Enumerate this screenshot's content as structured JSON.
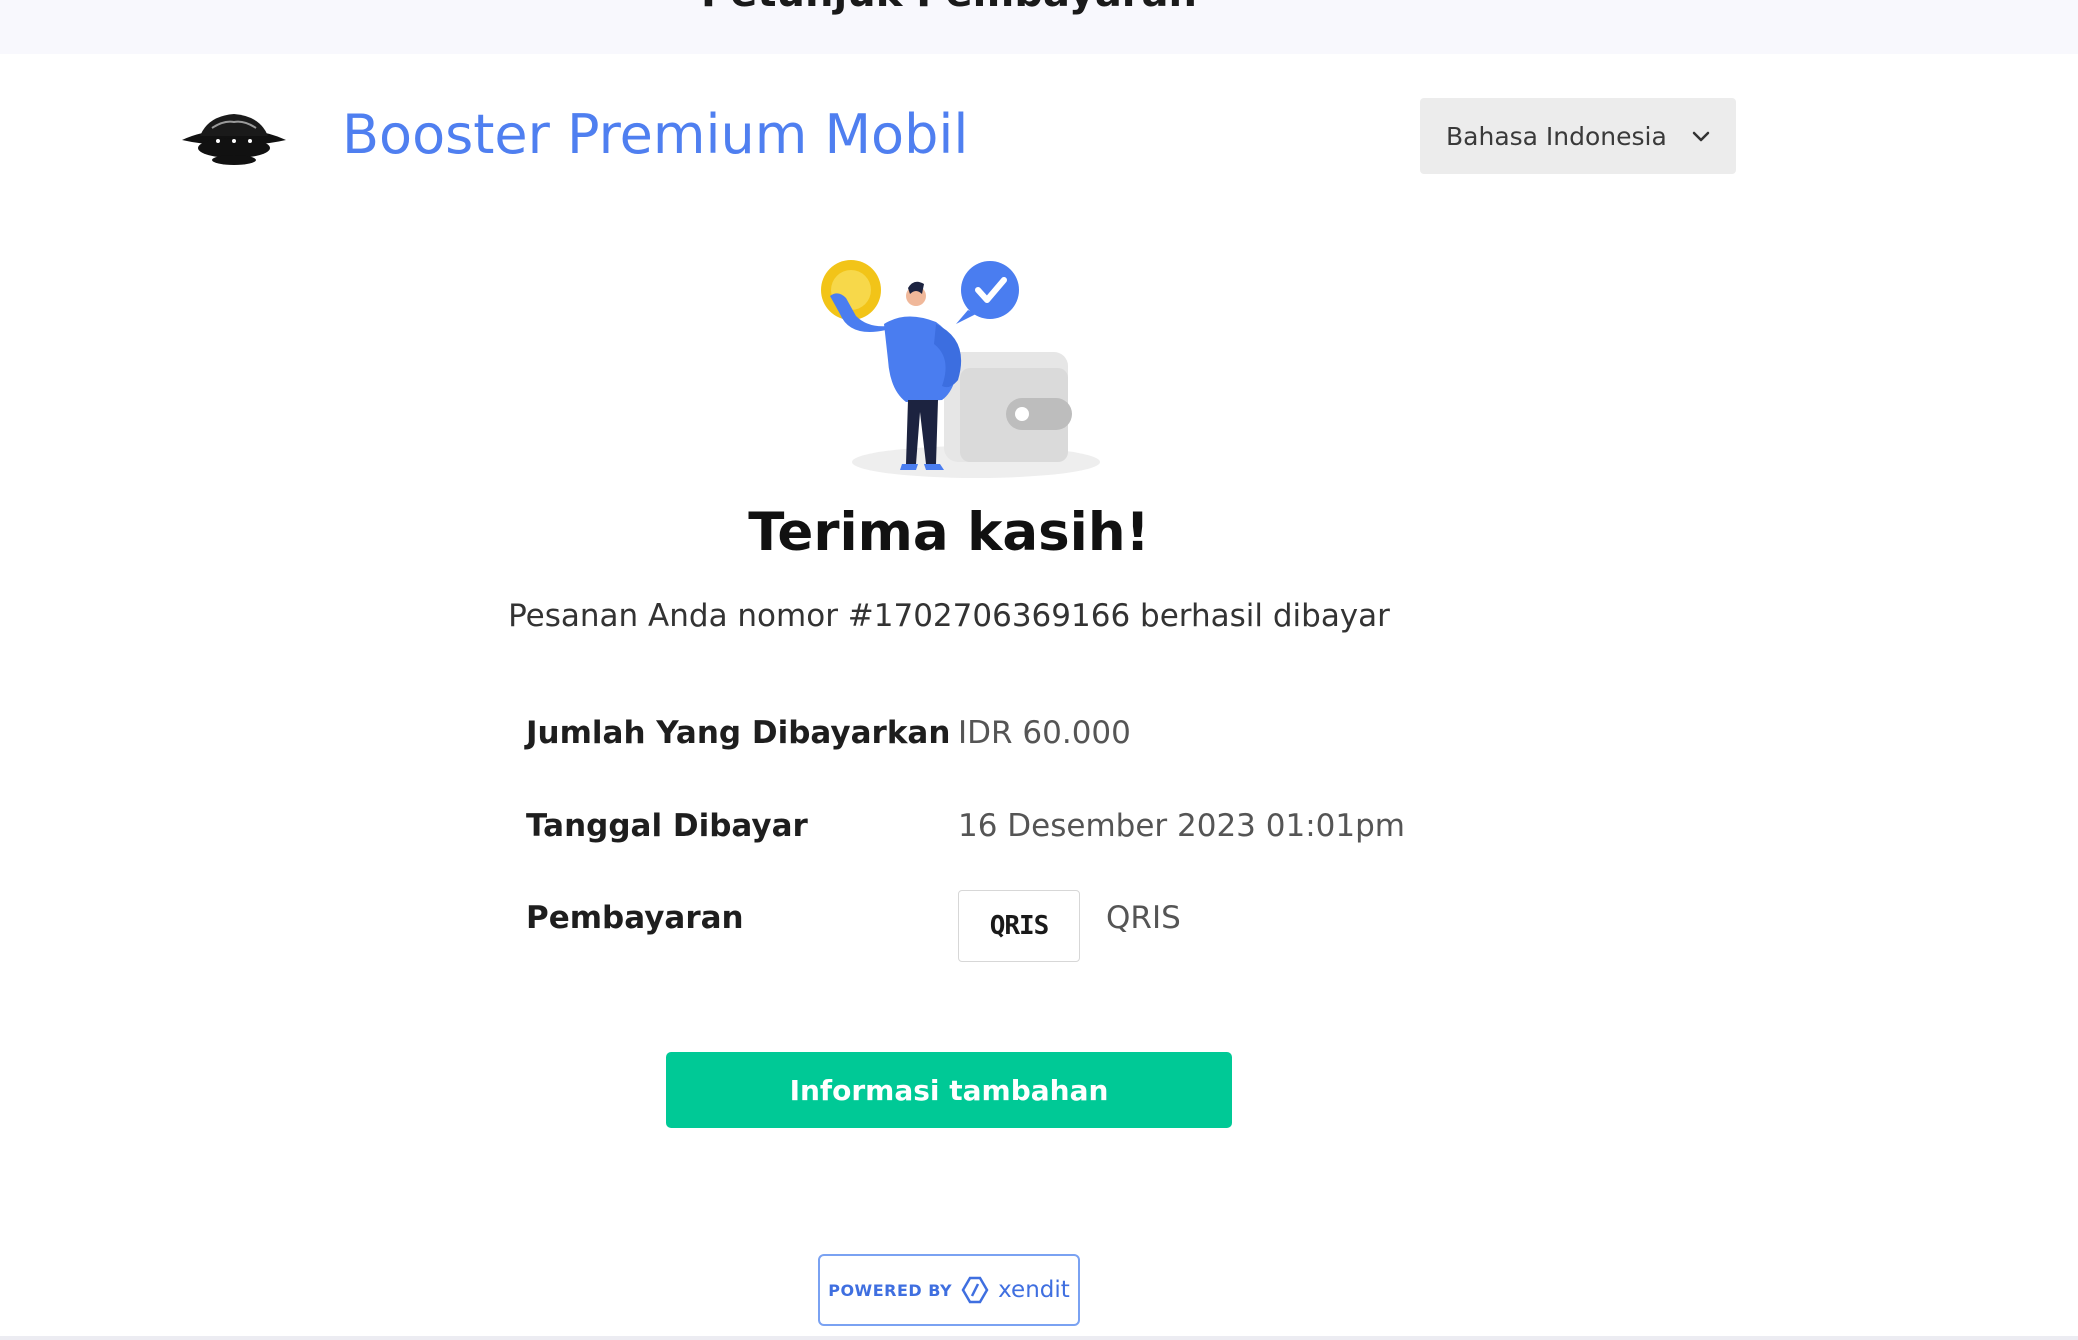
{
  "page": {
    "header_partial_title": "Petunjuk Pembayaran"
  },
  "header": {
    "merchant_name": "Booster Premium Mobil",
    "language_selected": "Bahasa Indonesia"
  },
  "success": {
    "title": "Terima kasih!",
    "message": "Pesanan Anda nomor #1702706369166 berhasil dibayar"
  },
  "details": {
    "amount_label": "Jumlah Yang Dibayarkan",
    "amount_value": "IDR 60.000",
    "date_label": "Tanggal Dibayar",
    "date_value": "16 Desember 2023 01:01pm",
    "method_label": "Pembayaran",
    "method_logo_text": "QRIS",
    "method_value": "QRIS"
  },
  "actions": {
    "more_info_label": "Informasi tambahan"
  },
  "footer": {
    "powered_by_label": "POWERED BY",
    "brand": "xendit"
  },
  "colors": {
    "accent_blue": "#4f7ff0",
    "success_green": "#00c996",
    "language_bg": "#ececec"
  },
  "icons": {
    "language": "chevron-down-icon",
    "illustration": "payment-success-illustration"
  }
}
